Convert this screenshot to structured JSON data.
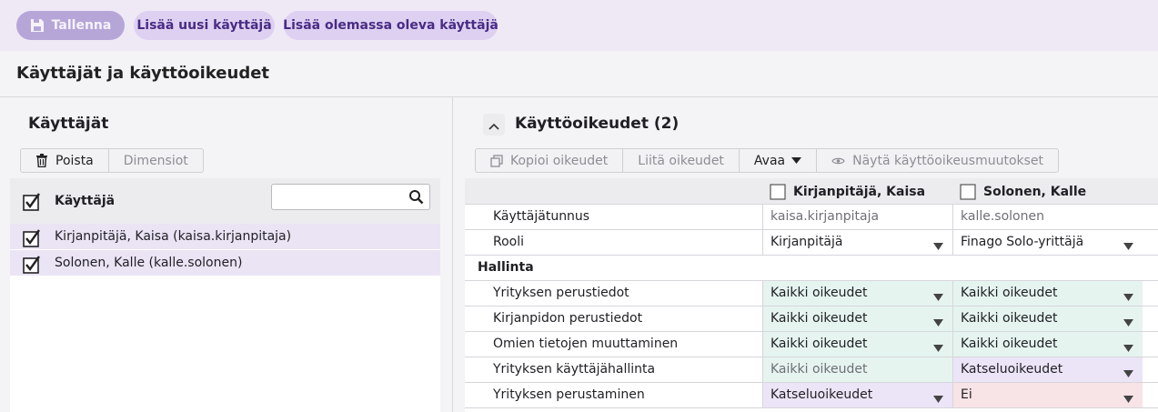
{
  "toolbar": {
    "save_label": "Tallenna",
    "add_new_user_label": "Lisää uusi käyttäjä",
    "add_existing_user_label": "Lisää olemassa oleva käyttäjä"
  },
  "page": {
    "title": "Käyttäjät ja käyttöoikeudet"
  },
  "users_panel": {
    "heading": "Käyttäjät",
    "delete_label": "Poista",
    "dimensions_label": "Dimensiot",
    "column_header": "Käyttäjä",
    "search_placeholder": "",
    "rows": [
      {
        "name": "Kirjanpitäjä, Kaisa (kaisa.kirjanpitaja)",
        "checked": true
      },
      {
        "name": "Solonen, Kalle (kalle.solonen)",
        "checked": true
      }
    ]
  },
  "permissions_panel": {
    "heading": "Käyttöoikeudet (2)",
    "copy_label": "Kopioi oikeudet",
    "paste_label": "Liitä oikeudet",
    "open_label": "Avaa",
    "show_changes_label": "Näytä käyttöoikeusmuutokset",
    "columns": [
      "Kirjanpitäjä, Kaisa",
      "Solonen, Kalle"
    ],
    "rows": {
      "username": {
        "label": "Käyttäjätunnus",
        "c1": "kaisa.kirjanpitaja",
        "c2": "kalle.solonen"
      },
      "role": {
        "label": "Rooli",
        "c1": "Kirjanpitäjä",
        "c2": "Finago Solo-yrittäjä"
      },
      "section_admin": "Hallinta",
      "company_basic": {
        "label": "Yrityksen perustiedot",
        "c1": "Kaikki oikeudet",
        "c2": "Kaikki oikeudet"
      },
      "accounting_basic": {
        "label": "Kirjanpidon perustiedot",
        "c1": "Kaikki oikeudet",
        "c2": "Kaikki oikeudet"
      },
      "own_info": {
        "label": "Omien tietojen muuttaminen",
        "c1": "Kaikki oikeudet",
        "c2": "Kaikki oikeudet"
      },
      "user_admin": {
        "label": "Yrityksen käyttäjähallinta",
        "c1": "Kaikki oikeudet",
        "c2": "Katseluoikeudet"
      },
      "company_create": {
        "label": "Yrityksen perustaminen",
        "c1": "Katseluoikeudet",
        "c2": "Ei"
      }
    }
  },
  "colors": {
    "accent": "#4a2b85",
    "toolbar_bg": "#efe9f6",
    "full_rights": "#e6f4ef",
    "view_rights": "#ece4f7",
    "no_rights": "#f8e3e6"
  }
}
